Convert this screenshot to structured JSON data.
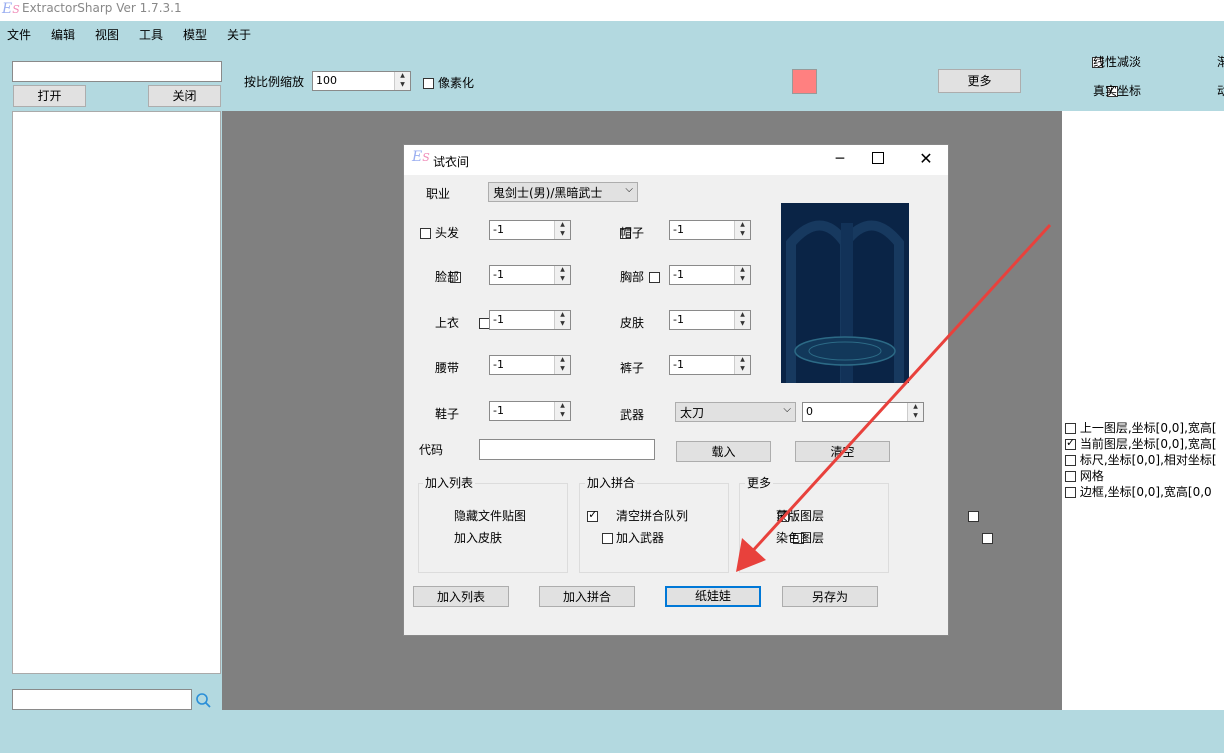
{
  "app": {
    "title": "ExtractorSharp Ver 1.7.3.1",
    "logo_e": "E",
    "logo_s": "S"
  },
  "menu": [
    "文件",
    "编辑",
    "视图",
    "工具",
    "模型",
    "关于"
  ],
  "toolbar": {
    "path_value": "",
    "open_label": "打开",
    "close_label": "关闭",
    "scale_label": "按比例缩放",
    "scale_value": "100",
    "pixelate_label": "像素化",
    "color_swatch": "#ff8080",
    "more_label": "更多",
    "linear_fade_label": "线性减淡",
    "real_coords_label": "真实坐标",
    "cut1": "渐",
    "cut2": "动"
  },
  "search": {
    "value": ""
  },
  "layers": [
    {
      "label": "上一图层,坐标[0,0],宽高[",
      "checked": false
    },
    {
      "label": "当前图层,坐标[0,0],宽高[",
      "checked": true
    },
    {
      "label": "标尺,坐标[0,0],相对坐标[",
      "checked": false
    },
    {
      "label": "网格",
      "checked": false
    },
    {
      "label": "边框,坐标[0,0],宽高[0,0",
      "checked": false
    }
  ],
  "dialog": {
    "title": "试衣间",
    "job_label": "职业",
    "job_value": "鬼剑士(男)/黑暗武士",
    "slots": {
      "hair": {
        "label": "头发",
        "value": "-1"
      },
      "cap": {
        "label": "帽子",
        "value": "-1"
      },
      "face": {
        "label": "脸部",
        "value": "-1"
      },
      "chest": {
        "label": "胸部",
        "value": "-1"
      },
      "coat": {
        "label": "上衣",
        "value": "-1"
      },
      "skin": {
        "label": "皮肤",
        "value": "-1"
      },
      "belt": {
        "label": "腰带",
        "value": "-1"
      },
      "pants": {
        "label": "裤子",
        "value": "-1"
      },
      "shoes": {
        "label": "鞋子",
        "value": "-1"
      },
      "weapon": {
        "label": "武器",
        "type": "太刀",
        "value": "0"
      }
    },
    "code_label": "代码",
    "code_value": "",
    "load_label": "载入",
    "clear_label": "清空",
    "group_list": {
      "title": "加入列表",
      "hide_files": "隐藏文件贴图",
      "add_skin": "加入皮肤"
    },
    "group_merge": {
      "title": "加入拼合",
      "clear_queue": "清空拼合队列",
      "add_weapon": "加入武器"
    },
    "group_more": {
      "title": "更多",
      "mask_layer": "蒙版图层",
      "dye_layer": "染色图层"
    },
    "btn_add_list": "加入列表",
    "btn_add_merge": "加入拼合",
    "btn_paper_doll": "纸娃娃",
    "btn_save_as": "另存为"
  },
  "annotation": {
    "arrow_color": "#e8413c"
  }
}
